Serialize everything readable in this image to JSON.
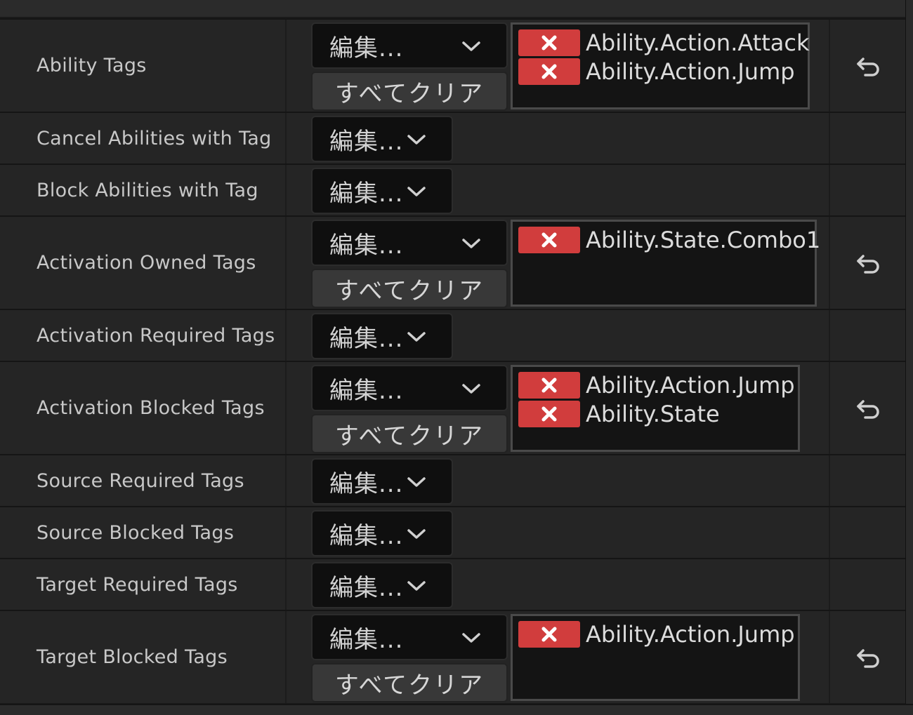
{
  "colors": {
    "background": "#1a1a1a",
    "row": "#252525",
    "edit_button": "#0f0f0f",
    "clear_button": "#383838",
    "tag_remove": "#d13d3d",
    "text": "#c8c8c8"
  },
  "rows": [
    {
      "label": "Ability Tags",
      "edit_label": "編集...",
      "clear_label": "すべてクリア",
      "tags": [
        "Ability.Action.Attack",
        "Ability.Action.Jump"
      ]
    },
    {
      "label": "Cancel Abilities with Tag",
      "edit_label": "編集..."
    },
    {
      "label": "Block Abilities with Tag",
      "edit_label": "編集..."
    },
    {
      "label": "Activation Owned Tags",
      "edit_label": "編集...",
      "clear_label": "すべてクリア",
      "tags": [
        "Ability.State.Combo1"
      ]
    },
    {
      "label": "Activation Required Tags",
      "edit_label": "編集..."
    },
    {
      "label": "Activation Blocked Tags",
      "edit_label": "編集...",
      "clear_label": "すべてクリア",
      "tags": [
        "Ability.Action.Jump",
        "Ability.State"
      ]
    },
    {
      "label": "Source Required Tags",
      "edit_label": "編集..."
    },
    {
      "label": "Source Blocked Tags",
      "edit_label": "編集..."
    },
    {
      "label": "Target Required Tags",
      "edit_label": "編集..."
    },
    {
      "label": "Target Blocked Tags",
      "edit_label": "編集...",
      "clear_label": "すべてクリア",
      "tags": [
        "Ability.Action.Jump"
      ]
    }
  ]
}
